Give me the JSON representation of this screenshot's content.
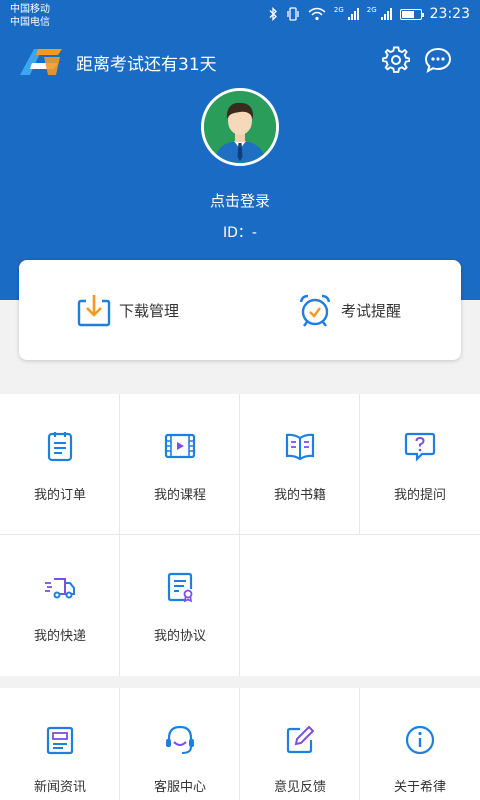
{
  "status_bar": {
    "carrier1": "中国移动",
    "carrier2": "中国电信",
    "net1": "2G",
    "net2": "2G",
    "time": "23:23"
  },
  "header": {
    "countdown": "距离考试还有31天",
    "login_label": "点击登录",
    "id_label": "ID：-",
    "background_color": "#1a6bc4"
  },
  "card": {
    "download_label": "下载管理",
    "alarm_label": "考试提醒"
  },
  "grid1": [
    {
      "label": "我的订单",
      "icon": "order-icon"
    },
    {
      "label": "我的课程",
      "icon": "course-icon"
    },
    {
      "label": "我的书籍",
      "icon": "book-icon"
    },
    {
      "label": "我的提问",
      "icon": "question-icon"
    },
    {
      "label": "我的快递",
      "icon": "truck-icon"
    },
    {
      "label": "我的协议",
      "icon": "agreement-icon"
    }
  ],
  "grid2": [
    {
      "label": "新闻资讯",
      "icon": "news-icon"
    },
    {
      "label": "客服中心",
      "icon": "service-icon"
    },
    {
      "label": "意见反馈",
      "icon": "feedback-icon"
    },
    {
      "label": "关于希律",
      "icon": "info-icon"
    }
  ],
  "colors": {
    "accent_blue": "#1e7fe0",
    "accent_orange": "#f39a22",
    "avatar_green": "#2a9d5a"
  }
}
